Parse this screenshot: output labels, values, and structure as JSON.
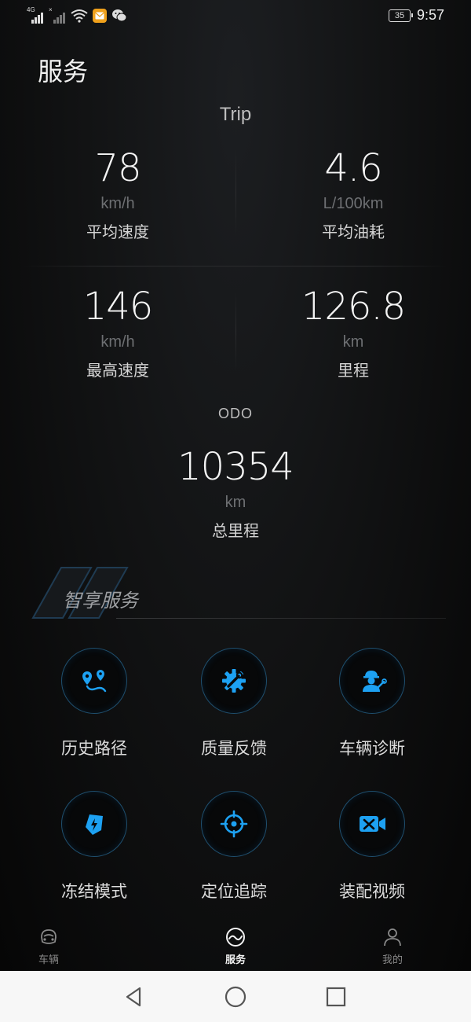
{
  "status_bar": {
    "sim1_tag": "4G",
    "sim2_tag": "×",
    "battery": "35",
    "time": "9:57"
  },
  "page_title": "服务",
  "trip": {
    "title": "Trip",
    "stats": [
      {
        "value": "78",
        "unit": "km/h",
        "label": "平均速度"
      },
      {
        "value": "4.6",
        "unit": "L/100km",
        "label": "平均油耗"
      },
      {
        "value": "146",
        "unit": "km/h",
        "label": "最高速度"
      },
      {
        "value": "126.8",
        "unit": "km",
        "label": "里程"
      }
    ]
  },
  "odo": {
    "title": "ODO",
    "value": "10354",
    "unit": "km",
    "label": "总里程"
  },
  "smart_service": {
    "title": "智享服务",
    "items": [
      {
        "label": "历史路径",
        "icon": "route-history-icon"
      },
      {
        "label": "质量反馈",
        "icon": "gear-wrench-icon"
      },
      {
        "label": "车辆诊断",
        "icon": "mechanic-icon"
      },
      {
        "label": "冻结模式",
        "icon": "shield-bolt-icon"
      },
      {
        "label": "定位追踪",
        "icon": "locate-target-icon"
      },
      {
        "label": "装配视频",
        "icon": "video-tools-icon"
      }
    ]
  },
  "bottom_nav": {
    "items": [
      {
        "label": "车辆",
        "icon": "vehicle-icon",
        "active": false
      },
      {
        "label": "服务",
        "icon": "service-icon",
        "active": true
      },
      {
        "label": "我的",
        "icon": "profile-icon",
        "active": false
      }
    ]
  },
  "colors": {
    "accent": "#1da1f2",
    "background": "#0b0b0c",
    "nav_active": "#f2f2f2"
  }
}
